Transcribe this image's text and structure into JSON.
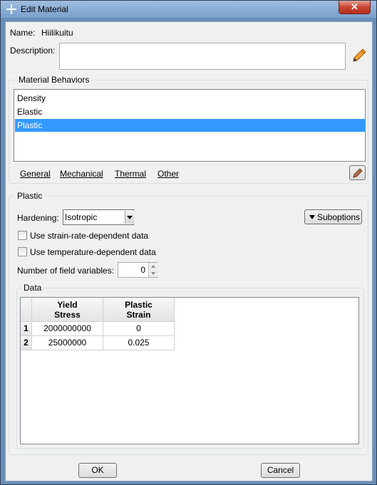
{
  "window": {
    "title": "Edit Material",
    "close_glyph": "✕"
  },
  "name": {
    "label": "Name:",
    "value": "Hiilikuitu"
  },
  "description": {
    "label": "Description:",
    "value": ""
  },
  "behaviors": {
    "legend": "Material Behaviors",
    "items": [
      {
        "label": "Density",
        "selected": false
      },
      {
        "label": "Elastic",
        "selected": false
      },
      {
        "label": "Plastic",
        "selected": true
      }
    ],
    "selected_color": "#3399ff"
  },
  "menubar": {
    "items": [
      "General",
      "Mechanical",
      "Thermal",
      "Other"
    ]
  },
  "plastic": {
    "legend": "Plastic",
    "hardening": {
      "label": "Hardening:",
      "value": "Isotropic"
    },
    "suboptions_label": "Suboptions",
    "strain_rate": {
      "label": "Use strain-rate-dependent data",
      "checked": false
    },
    "temperature": {
      "label": "Use temperature-dependent data",
      "checked": false
    },
    "field_vars": {
      "label": "Number of field variables:",
      "value": "0"
    },
    "data": {
      "legend": "Data",
      "columns": [
        {
          "line1": "Yield",
          "line2": "Stress"
        },
        {
          "line1": "Plastic",
          "line2": "Strain"
        }
      ],
      "rows": [
        {
          "index": "1",
          "cells": [
            "2000000000",
            "0"
          ]
        },
        {
          "index": "2",
          "cells": [
            "25000000",
            "0.025"
          ]
        }
      ]
    }
  },
  "buttons": {
    "ok": "OK",
    "cancel": "Cancel"
  },
  "icons": {
    "edit": "pencil-icon",
    "window": "app-icon",
    "dropdown": "chevron-down-icon",
    "suboptions": "triangle-down-icon"
  }
}
